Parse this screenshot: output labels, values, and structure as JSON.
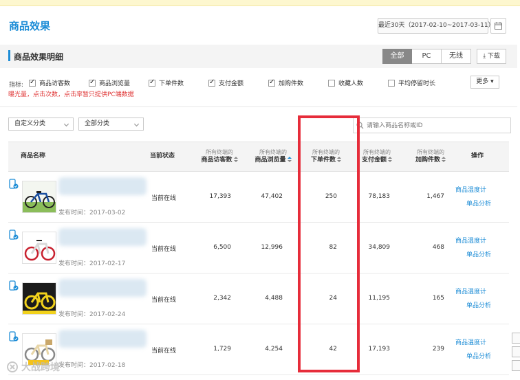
{
  "notice": {
    "text": ""
  },
  "header": {
    "title": "商品效果",
    "date_range": "最近30天（2017-02-10~2017-03-11）"
  },
  "section": {
    "title": "商品效果明细",
    "tabs": [
      {
        "label": "全部",
        "active": true
      },
      {
        "label": "PC",
        "active": false
      },
      {
        "label": "无线",
        "active": false
      }
    ],
    "download_label": "下载"
  },
  "metrics": {
    "label": "指标:",
    "items": [
      {
        "label": "商品访客数",
        "checked": true
      },
      {
        "label": "商品浏览量",
        "checked": true
      },
      {
        "label": "下单件数",
        "checked": true
      },
      {
        "label": "支付金额",
        "checked": true
      },
      {
        "label": "加购件数",
        "checked": true
      },
      {
        "label": "收藏人数",
        "checked": false
      },
      {
        "label": "平均停留时长",
        "checked": false
      }
    ],
    "more_label": "更多",
    "warning": "曝光量，点击次数，点击率暂只提供PC端数据"
  },
  "filters": {
    "custom_category": "自定义分类",
    "all_category": "全部分类",
    "search_placeholder": "请输入商品名称或ID"
  },
  "table": {
    "columns": {
      "name": "商品名称",
      "status": "当前状态",
      "visitors_sub": "所有终端的",
      "visitors": "商品访客数",
      "views_sub": "所有终端的",
      "views": "商品浏览量",
      "orders_sub": "所有终端的",
      "orders": "下单件数",
      "payment_sub": "所有终端的",
      "payment": "支付金额",
      "cart_sub": "所有终端的",
      "cart": "加购件数",
      "ops": "操作"
    },
    "rows": [
      {
        "publish": "发布时间：2017-03-02",
        "status": "当前在线",
        "visitors": "17,393",
        "views": "47,402",
        "orders": "250",
        "payment": "78,183",
        "cart": "1,467",
        "op1": "商品温度计",
        "op2": "单品分析"
      },
      {
        "publish": "发布时间：2017-02-17",
        "status": "当前在线",
        "visitors": "6,500",
        "views": "12,996",
        "orders": "82",
        "payment": "34,809",
        "cart": "468",
        "op1": "商品温度计",
        "op2": "单品分析"
      },
      {
        "publish": "发布时间：2017-02-24",
        "status": "当前在线",
        "visitors": "2,342",
        "views": "4,488",
        "orders": "24",
        "payment": "11,195",
        "cart": "165",
        "op1": "商品温度计",
        "op2": "单品分析"
      },
      {
        "publish": "发布时间：2017-02-18",
        "status": "当前在线",
        "visitors": "1,729",
        "views": "4,254",
        "orders": "42",
        "payment": "17,193",
        "cart": "239",
        "op1": "商品温度计",
        "op2": "单品分析"
      }
    ]
  },
  "watermark": {
    "text": "大战跨境"
  },
  "colors": {
    "accent": "#1c8cd6",
    "warning": "#e03a3a",
    "highlight": "#e62c3a"
  }
}
